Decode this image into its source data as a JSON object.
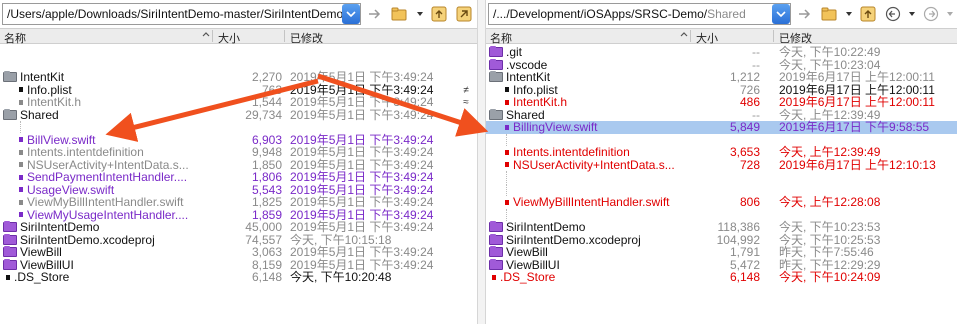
{
  "left": {
    "path": "/Users/apple/Downloads/SiriIntentDemo-master/SiriIntentDemo",
    "columns": {
      "name": "名称",
      "size": "大小",
      "modified": "已修改"
    },
    "rows": [
      {
        "name": "IntentKit",
        "size": "2,270",
        "date": "2019年5月1日 下午3:49:24",
        "type": "folder",
        "color": "black",
        "indent": 0
      },
      {
        "name": "Info.plist",
        "size": "763",
        "date": "2019年5月1日 下午3:49:24",
        "type": "file",
        "color": "black",
        "indent": 1
      },
      {
        "name": "IntentKit.h",
        "size": "1,544",
        "date": "2019年5月1日 下午3:49:24",
        "type": "file",
        "color": "gray",
        "indent": 1
      },
      {
        "name": "Shared",
        "size": "29,734",
        "date": "2019年5月1日 下午3:49:24",
        "type": "folder",
        "color": "black",
        "indent": 0
      },
      {
        "name": "",
        "size": "",
        "date": "",
        "type": "blank",
        "color": "black",
        "indent": 1
      },
      {
        "name": "BillView.swift",
        "size": "6,903",
        "date": "2019年5月1日 下午3:49:24",
        "type": "file",
        "color": "purple",
        "indent": 1
      },
      {
        "name": "Intents.intentdefinition",
        "size": "9,948",
        "date": "2019年5月1日 下午3:49:24",
        "type": "file",
        "color": "gray",
        "indent": 1
      },
      {
        "name": "NSUserActivity+IntentData.s...",
        "size": "1,850",
        "date": "2019年5月1日 下午3:49:24",
        "type": "file",
        "color": "gray",
        "indent": 1
      },
      {
        "name": "SendPaymentIntentHandler....",
        "size": "1,806",
        "date": "2019年5月1日 下午3:49:24",
        "type": "file",
        "color": "purple",
        "indent": 1
      },
      {
        "name": "UsageView.swift",
        "size": "5,543",
        "date": "2019年5月1日 下午3:49:24",
        "type": "file",
        "color": "purple",
        "indent": 1
      },
      {
        "name": "ViewMyBillIntentHandler.swift",
        "size": "1,825",
        "date": "2019年5月1日 下午3:49:24",
        "type": "file",
        "color": "gray",
        "indent": 1
      },
      {
        "name": "ViewMyUsageIntentHandler....",
        "size": "1,859",
        "date": "2019年5月1日 下午3:49:24",
        "type": "file",
        "color": "purple",
        "indent": 1
      },
      {
        "name": "SiriIntentDemo",
        "size": "45,000",
        "date": "2019年5月1日 下午3:49:24",
        "type": "folder",
        "color": "black",
        "indent": 0
      },
      {
        "name": "SiriIntentDemo.xcodeproj",
        "size": "74,557",
        "date": "今天, 下午10:15:18",
        "type": "folder",
        "color": "black",
        "indent": 0
      },
      {
        "name": "ViewBill",
        "size": "3,063",
        "date": "2019年5月1日 下午3:49:24",
        "type": "folder",
        "color": "black",
        "indent": 0
      },
      {
        "name": "ViewBillUI",
        "size": "8,159",
        "date": "2019年5月1日 下午3:49:24",
        "type": "folder",
        "color": "black",
        "indent": 0
      },
      {
        "name": ".DS_Store",
        "size": "6,148",
        "date": "今天, 下午10:20:48",
        "type": "file",
        "color": "black",
        "indent": 0
      }
    ]
  },
  "right": {
    "path_prefix": "/.../Development/iOSApps/SRSC-Demo/",
    "path_last": "Shared",
    "columns": {
      "name": "名称",
      "size": "大小",
      "modified": "已修改"
    },
    "rows": [
      {
        "name": ".git",
        "size": "--",
        "date": "今天, 下午10:22:49",
        "type": "folder",
        "color": "black",
        "indent": 0
      },
      {
        "name": ".vscode",
        "size": "--",
        "date": "今天, 下午10:23:04",
        "type": "folder",
        "color": "black",
        "indent": 0
      },
      {
        "name": "IntentKit",
        "size": "1,212",
        "date": "2019年6月17日 上午12:00:11",
        "type": "folder",
        "color": "black",
        "indent": 0
      },
      {
        "name": "Info.plist",
        "size": "726",
        "date": "2019年6月17日 上午12:00:11",
        "type": "file",
        "color": "black",
        "indent": 1
      },
      {
        "name": "IntentKit.h",
        "size": "486",
        "date": "2019年6月17日 上午12:00:11",
        "type": "file",
        "color": "red",
        "indent": 1
      },
      {
        "name": "Shared",
        "size": "--",
        "date": "今天, 上午12:39:49",
        "type": "folder",
        "color": "black",
        "indent": 0
      },
      {
        "name": "BillingView.swift",
        "size": "5,849",
        "date": "2019年6月17日 下午9:58:55",
        "type": "file",
        "color": "purple",
        "indent": 1,
        "selected": true
      },
      {
        "name": "",
        "size": "",
        "date": "",
        "type": "blank",
        "color": "black",
        "indent": 1
      },
      {
        "name": "Intents.intentdefinition",
        "size": "3,653",
        "date": "今天, 上午12:39:49",
        "type": "file",
        "color": "red",
        "indent": 1
      },
      {
        "name": "NSUserActivity+IntentData.s...",
        "size": "728",
        "date": "2019年6月17日 上午12:10:13",
        "type": "file",
        "color": "red",
        "indent": 1
      },
      {
        "name": "",
        "size": "",
        "date": "",
        "type": "blank",
        "color": "black",
        "indent": 1
      },
      {
        "name": "",
        "size": "",
        "date": "",
        "type": "blank",
        "color": "black",
        "indent": 1
      },
      {
        "name": "ViewMyBillIntentHandler.swift",
        "size": "806",
        "date": "今天, 上午12:28:08",
        "type": "file",
        "color": "red",
        "indent": 1
      },
      {
        "name": "",
        "size": "",
        "date": "",
        "type": "blank",
        "color": "black",
        "indent": 1
      },
      {
        "name": "SiriIntentDemo",
        "size": "118,386",
        "date": "今天, 下午10:23:53",
        "type": "folder",
        "color": "black",
        "indent": 0
      },
      {
        "name": "SiriIntentDemo.xcodeproj",
        "size": "104,992",
        "date": "今天, 下午10:25:53",
        "type": "folder",
        "color": "black",
        "indent": 0
      },
      {
        "name": "ViewBill",
        "size": "1,791",
        "date": "昨天, 下午7:55:46",
        "type": "folder",
        "color": "black",
        "indent": 0
      },
      {
        "name": "ViewBillUI",
        "size": "5,472",
        "date": "昨天, 下午12:29:29",
        "type": "folder",
        "color": "black",
        "indent": 0
      },
      {
        "name": ".DS_Store",
        "size": "6,148",
        "date": "今天, 下午10:24:09",
        "type": "file",
        "color": "red",
        "indent": 0
      }
    ]
  },
  "gutter_markers": {
    "row2": "≠",
    "row3": "≈"
  },
  "colors": {
    "purple": "#7a2ac8",
    "red": "#e00000",
    "gray": "#8a8a8a",
    "arrow": "#f0501e",
    "selection": "#a9c9ef"
  }
}
